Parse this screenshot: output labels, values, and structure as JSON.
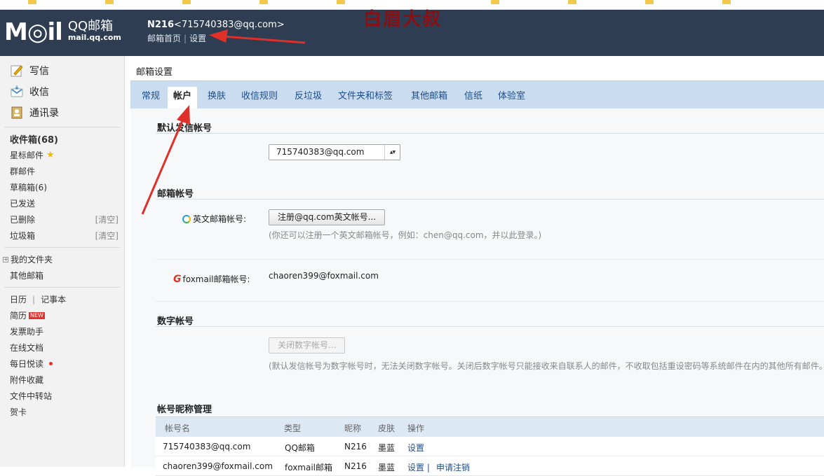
{
  "header": {
    "logo_mark": "M◎il",
    "logo_name": "QQ邮箱",
    "logo_url": "mail.qq.com",
    "user_nick": "N216",
    "user_email": "<715740383@qq.com>",
    "link_home": "邮箱首页",
    "link_sep": "|",
    "link_settings": "设置",
    "watermark": "白眉大叔"
  },
  "sidebar": {
    "compose": "写信",
    "inbox_action": "收信",
    "contacts": "通讯录",
    "folders": [
      {
        "label": "收件箱(68)"
      },
      {
        "label": "星标邮件"
      },
      {
        "label": "群邮件"
      },
      {
        "label": "草稿箱(6)"
      },
      {
        "label": "已发送"
      },
      {
        "label": "已删除",
        "action": "[清空]"
      },
      {
        "label": "垃圾箱",
        "action": "[清空]"
      }
    ],
    "my_folders": "我的文件夹",
    "other_mailboxes": "其他邮箱",
    "calendar": "日历",
    "notes_sep": "|",
    "notes": "记事本",
    "resume": "简历",
    "new_badge": "NEW",
    "tools": [
      "发票助手",
      "在线文档",
      "每日悦读",
      "附件收藏",
      "文件中转站",
      "贺卡"
    ]
  },
  "main": {
    "title": "邮箱设置",
    "tabs": [
      "常规",
      "帐户",
      "换肤",
      "收信规则",
      "反垃圾",
      "文件夹和标签",
      "其他邮箱",
      "信纸",
      "体验室"
    ],
    "active_tab": "帐户",
    "default_sender": {
      "title": "默认发信帐号",
      "value": "715740383@qq.com"
    },
    "mail_accounts": {
      "title": "邮箱帐号",
      "english_label": "英文邮箱帐号:",
      "english_button": "注册@qq.com英文帐号...",
      "english_hint": "(你还可以注册一个英文邮箱帐号，例如：chen@qq.com，并以此登录。)",
      "foxmail_label": "foxmail邮箱帐号:",
      "foxmail_value": "chaoren399@foxmail.com"
    },
    "digital_account": {
      "title": "数字帐号",
      "button": "关闭数字帐号...",
      "hint": "(默认发信帐号为数字帐号时，无法关闭数字帐号。关闭后数字帐号只能接收来自联系人的邮件，不收取包括重设密码等系统邮件在内的其他所有邮件。)"
    },
    "nickname_mgmt": {
      "title": "帐号昵称管理",
      "columns": [
        "帐号名",
        "类型",
        "昵称",
        "皮肤",
        "操作"
      ],
      "rows": [
        {
          "account": "715740383@qq.com",
          "type": "QQ邮箱",
          "nick": "N216",
          "skin": "墨蓝",
          "ops": "设置",
          "ops_extra": ""
        },
        {
          "account": "chaoren399@foxmail.com",
          "type": "foxmail邮箱",
          "nick": "N216",
          "skin": "墨蓝",
          "ops": "设置 |",
          "ops_extra": "申请注销"
        }
      ]
    }
  },
  "colors": {
    "header_bg": "#2e3d52",
    "tab_bar": "#c9dcf0",
    "link": "#1f4e8a",
    "annotation_arrow": "#e0302a",
    "watermark": "#8b0f12"
  }
}
